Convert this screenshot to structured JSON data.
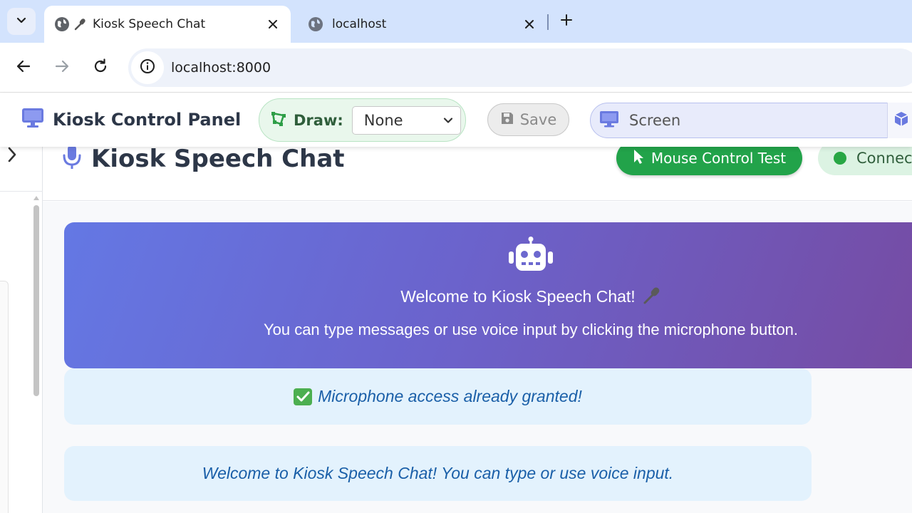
{
  "browser": {
    "tabs": [
      {
        "title": "Kiosk Speech Chat",
        "active": true
      },
      {
        "title": "localhost",
        "active": false
      }
    ],
    "url": "localhost:8000"
  },
  "panel": {
    "title": "Kiosk Control Panel",
    "draw_label": "Draw:",
    "draw_value": "None",
    "save_label": "Save",
    "screen_label": "Screen"
  },
  "chat": {
    "title": "Kiosk Speech Chat",
    "mouse_button": "Mouse Control Test",
    "status": "Connect",
    "welcome_title": "Welcome to Kiosk Speech Chat!",
    "welcome_sub": "You can type messages or use voice input by clicking the microphone button.",
    "messages": [
      "Microphone access already granted!",
      "Welcome to Kiosk Speech Chat! You can type or use voice input."
    ]
  },
  "colors": {
    "accent": "#667eea",
    "gradient_end": "#764ba2",
    "success": "#22a34a",
    "message_bg": "#e3f2fd",
    "message_text": "#1a5fa8"
  },
  "icons": [
    "tab-search-icon",
    "globe-icon",
    "microphone-icon",
    "close-icon",
    "plus-icon",
    "back-arrow-icon",
    "forward-arrow-icon",
    "reload-icon",
    "info-icon",
    "desktop-icon",
    "draw-shape-icon",
    "chevron-down-icon",
    "floppy-disk-icon",
    "cube-icon",
    "chevron-right-icon",
    "mouse-pointer-icon",
    "robot-icon",
    "check-box-icon"
  ]
}
